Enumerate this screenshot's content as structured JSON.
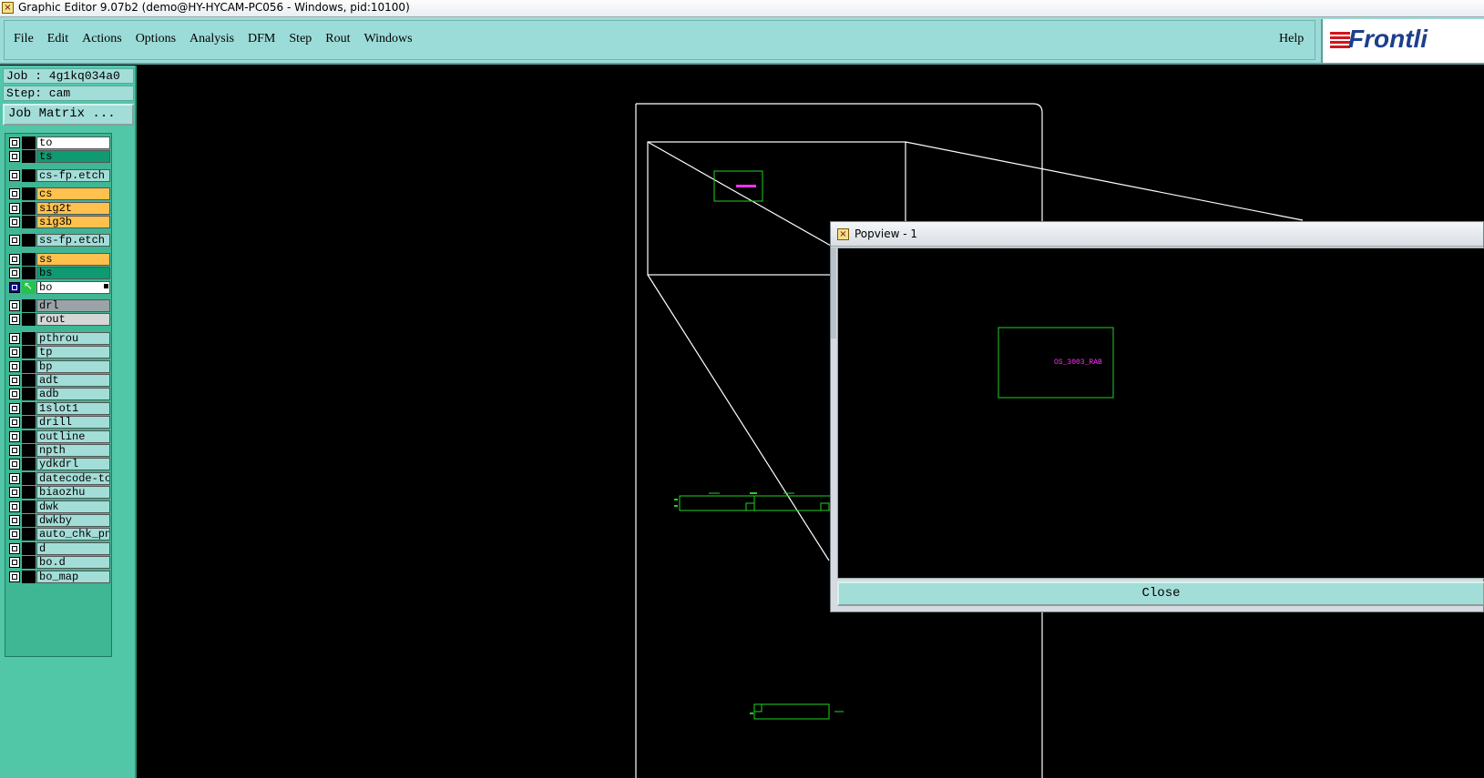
{
  "window": {
    "title": "Graphic Editor 9.07b2 (demo@HY-HYCAM-PC056 - Windows, pid:10100)",
    "app_icon": "x-window-icon"
  },
  "menubar": {
    "items": [
      {
        "label": "File"
      },
      {
        "label": "Edit"
      },
      {
        "label": "Actions"
      },
      {
        "label": "Options"
      },
      {
        "label": "Analysis"
      },
      {
        "label": "DFM"
      },
      {
        "label": "Step"
      },
      {
        "label": "Rout"
      },
      {
        "label": "Windows"
      }
    ],
    "help": "Help",
    "logo_text": "Frontli"
  },
  "left_panel": {
    "job": "Job : 4g1kq034a0",
    "step": "Step: cam",
    "job_matrix": "Job Matrix ...",
    "layers": [
      {
        "name": "to",
        "color": "#ffffff"
      },
      {
        "name": "ts",
        "color": "#0f9a72"
      },
      {
        "name": "cs-fp.etch",
        "color": "#a3ddd8"
      },
      {
        "name": "cs",
        "color": "#ffc14d"
      },
      {
        "name": "sig2t",
        "color": "#ffc14d"
      },
      {
        "name": "sig3b",
        "color": "#ffc14d"
      },
      {
        "name": "ss-fp.etch",
        "color": "#a3ddd8"
      },
      {
        "name": "ss",
        "color": "#ffc14d"
      },
      {
        "name": "bs",
        "color": "#0f9a72"
      },
      {
        "name": "bo",
        "color": "#ffffff",
        "active": true
      },
      {
        "name": "drl",
        "color": "#9aa3a8"
      },
      {
        "name": "rout",
        "color": "#d6d6d6"
      },
      {
        "name": "pthrou",
        "color": "#a3ddd8"
      },
      {
        "name": "tp",
        "color": "#a3ddd8"
      },
      {
        "name": "bp",
        "color": "#a3ddd8"
      },
      {
        "name": "adt",
        "color": "#a3ddd8"
      },
      {
        "name": "adb",
        "color": "#a3ddd8"
      },
      {
        "name": "1slot1",
        "color": "#a3ddd8"
      },
      {
        "name": "drill",
        "color": "#a3ddd8"
      },
      {
        "name": "outline",
        "color": "#a3ddd8"
      },
      {
        "name": "npth",
        "color": "#a3ddd8"
      },
      {
        "name": "ydkdrl",
        "color": "#a3ddd8"
      },
      {
        "name": "datecode-to",
        "color": "#a3ddd8"
      },
      {
        "name": "biaozhu",
        "color": "#a3ddd8"
      },
      {
        "name": "dwk",
        "color": "#a3ddd8"
      },
      {
        "name": "dwkby",
        "color": "#a3ddd8"
      },
      {
        "name": "auto_chk_pn",
        "color": "#a3ddd8"
      },
      {
        "name": "d",
        "color": "#a3ddd8"
      },
      {
        "name": "bo.d",
        "color": "#a3ddd8"
      },
      {
        "name": "bo_map",
        "color": "#a3ddd8"
      }
    ]
  },
  "popview": {
    "title": "Popview - 1",
    "close": "Close",
    "feature_text": "OS_3003_RAB"
  },
  "canvas": {
    "colors": {
      "outline": "#ffffff",
      "feature": "#1fd21f",
      "text": "#ff33ff"
    }
  }
}
